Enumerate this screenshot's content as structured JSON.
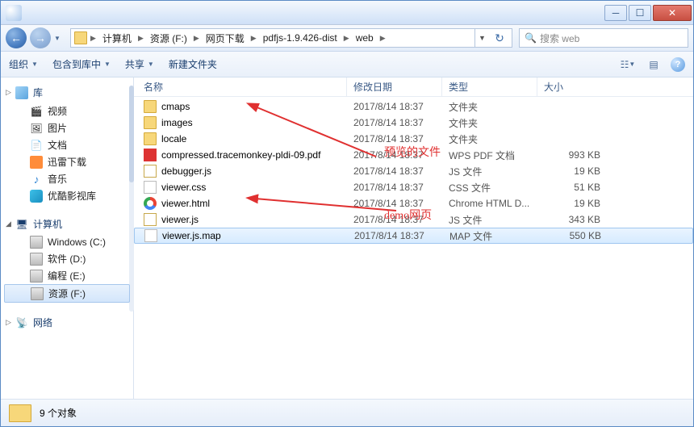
{
  "breadcrumb": [
    "计算机",
    "资源 (F:)",
    "网页下载",
    "pdfjs-1.9.426-dist",
    "web"
  ],
  "search_placeholder": "搜索 web",
  "toolbar": {
    "organize": "组织",
    "include": "包含到库中",
    "share": "共享",
    "newfolder": "新建文件夹"
  },
  "columns": {
    "name": "名称",
    "date": "修改日期",
    "type": "类型",
    "size": "大小"
  },
  "sidebar": {
    "lib_head": "库",
    "lib": [
      "视频",
      "图片",
      "文档",
      "迅雷下载",
      "音乐",
      "优酷影视库"
    ],
    "comp_head": "计算机",
    "comp": [
      "Windows (C:)",
      "软件 (D:)",
      "编程 (E:)",
      "资源 (F:)"
    ],
    "net_head": "网络"
  },
  "files": [
    {
      "icon": "folder",
      "name": "cmaps",
      "date": "2017/8/14 18:37",
      "type": "文件夹",
      "size": ""
    },
    {
      "icon": "folder",
      "name": "images",
      "date": "2017/8/14 18:37",
      "type": "文件夹",
      "size": ""
    },
    {
      "icon": "folder",
      "name": "locale",
      "date": "2017/8/14 18:37",
      "type": "文件夹",
      "size": ""
    },
    {
      "icon": "pdf",
      "name": "compressed.tracemonkey-pldi-09.pdf",
      "date": "2017/8/14 18:37",
      "type": "WPS PDF 文档",
      "size": "993 KB"
    },
    {
      "icon": "js",
      "name": "debugger.js",
      "date": "2017/8/14 18:37",
      "type": "JS 文件",
      "size": "19 KB"
    },
    {
      "icon": "file",
      "name": "viewer.css",
      "date": "2017/8/14 18:37",
      "type": "CSS 文件",
      "size": "51 KB"
    },
    {
      "icon": "chrome",
      "name": "viewer.html",
      "date": "2017/8/14 18:37",
      "type": "Chrome HTML D...",
      "size": "19 KB"
    },
    {
      "icon": "js",
      "name": "viewer.js",
      "date": "2017/8/14 18:37",
      "type": "JS 文件",
      "size": "343 KB"
    },
    {
      "icon": "file",
      "name": "viewer.js.map",
      "date": "2017/8/14 18:37",
      "type": "MAP 文件",
      "size": "550 KB",
      "selected": true
    }
  ],
  "status_text": "9 个对象",
  "annotations": {
    "preview": "预览的文件",
    "demo": "demo网页"
  }
}
